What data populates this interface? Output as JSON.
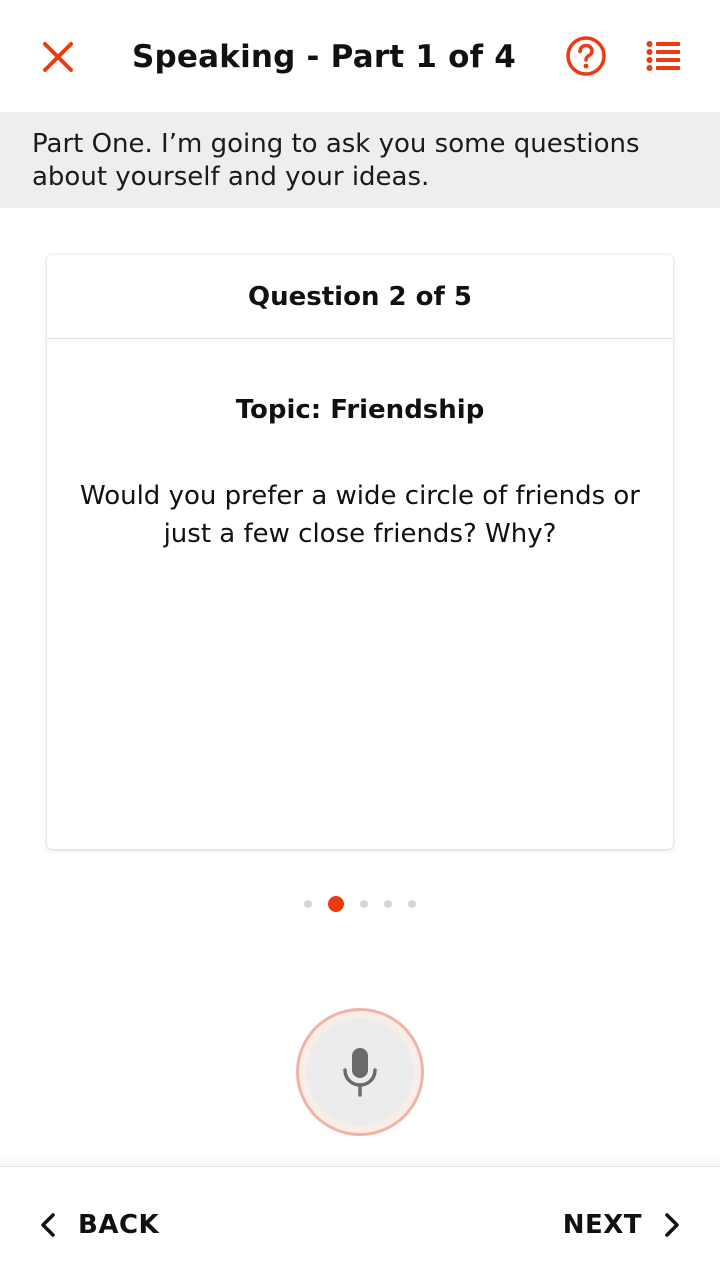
{
  "header": {
    "title": "Speaking - Part 1 of 4",
    "close_icon": "close-icon",
    "help_icon": "help-circle-icon",
    "menu_icon": "list-icon"
  },
  "instructions": {
    "text": "Part One. I’m going to ask you some questions about yourself and your ideas."
  },
  "card": {
    "header": "Question 2 of 5",
    "topic": "Topic: Friendship",
    "question": "Would you prefer a wide circle of friends or just a few close friends? Why?"
  },
  "pager": {
    "total": 5,
    "current": 2
  },
  "mic": {
    "icon": "microphone-icon"
  },
  "footer": {
    "back_label": "BACK",
    "next_label": "NEXT"
  },
  "colors": {
    "accent": "#ee3a0f",
    "banner_bg": "#eeeeee",
    "mic_ring": "#f0b4a6",
    "mic_icon": "#6b6b6b"
  }
}
